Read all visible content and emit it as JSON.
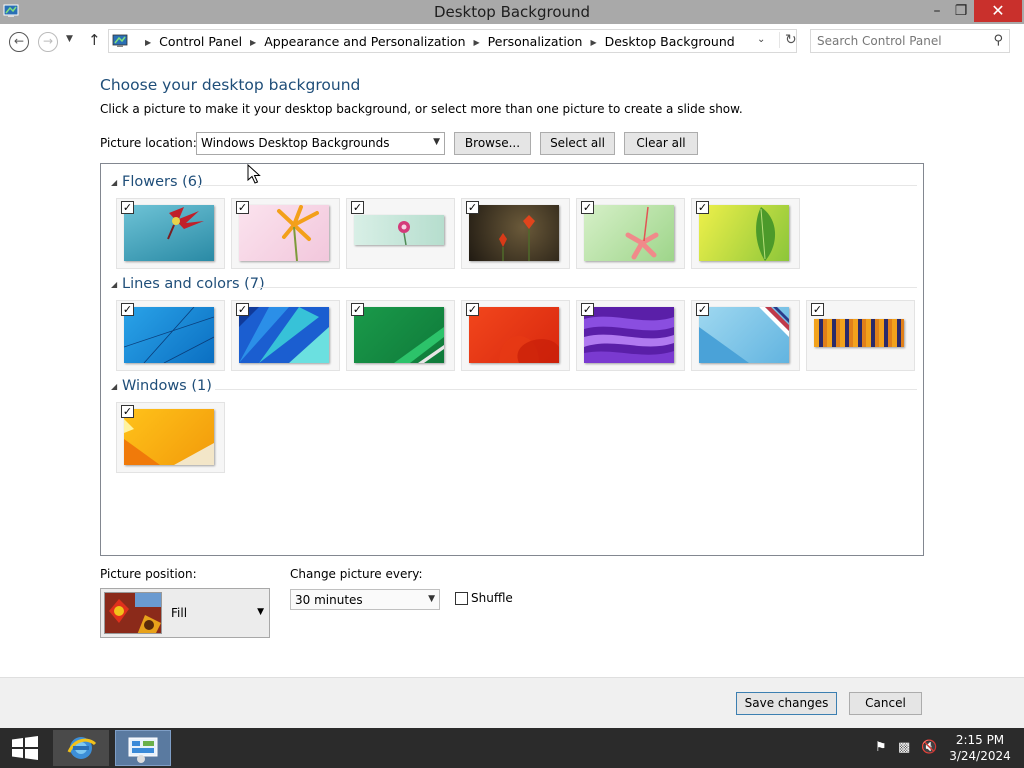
{
  "window": {
    "title": "Desktop Background"
  },
  "address": {
    "crumbs": [
      "Control Panel",
      "Appearance and Personalization",
      "Personalization",
      "Desktop Background"
    ],
    "search_placeholder": "Search Control Panel"
  },
  "page": {
    "heading": "Choose your desktop background",
    "subtext": "Click a picture to make it your desktop background, or select more than one picture to create a slide show.",
    "location_label": "Picture location:",
    "location_value": "Windows Desktop Backgrounds",
    "browse_label": "Browse...",
    "select_all_label": "Select all",
    "clear_all_label": "Clear all"
  },
  "groups": [
    {
      "name": "Flowers (6)",
      "count": 6
    },
    {
      "name": "Lines and colors (7)",
      "count": 7
    },
    {
      "name": "Windows (1)",
      "count": 1
    }
  ],
  "options": {
    "position_label": "Picture position:",
    "position_value": "Fill",
    "change_label": "Change picture every:",
    "change_value": "30 minutes",
    "shuffle_label": "Shuffle",
    "shuffle_checked": false
  },
  "footer": {
    "save_label": "Save changes",
    "cancel_label": "Cancel"
  },
  "taskbar": {
    "time": "2:15 PM",
    "date": "3/24/2024"
  },
  "colors": {
    "accent_text": "#1f4e79",
    "close_button": "#c9302c",
    "taskbar": "#2b2b2b"
  }
}
